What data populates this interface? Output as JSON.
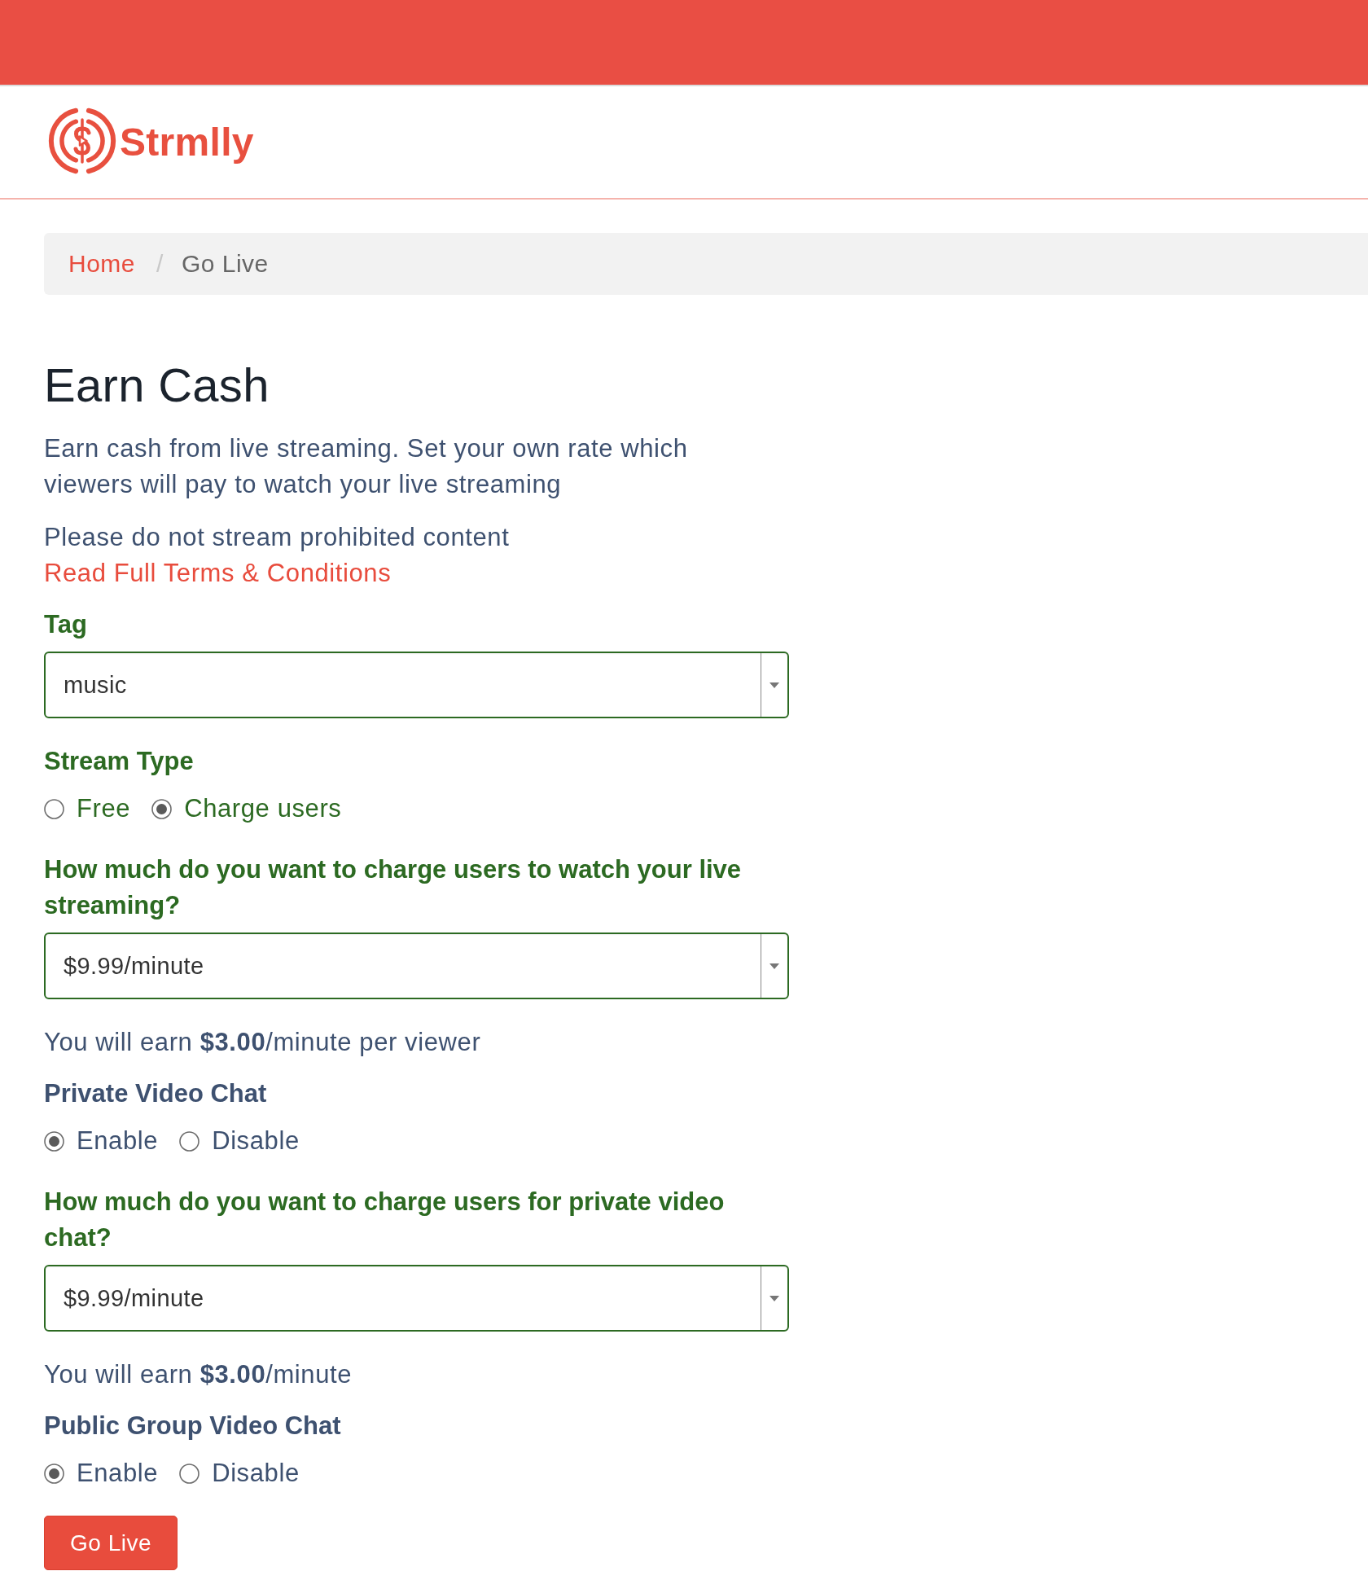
{
  "header": {
    "logo_text": "Strmlly"
  },
  "breadcrumb": {
    "separator": "/",
    "items": [
      {
        "label": "Home",
        "kind": "link"
      },
      {
        "label": "Go Live",
        "kind": "current"
      }
    ]
  },
  "page": {
    "title": "Earn Cash",
    "intro": "Earn cash from live streaming. Set your own rate which viewers will pay to watch your live streaming",
    "notice": "Please do not stream prohibited content",
    "terms_link": "Read Full Terms & Conditions"
  },
  "form": {
    "fields": [
      {
        "kind": "select",
        "label": "Tag",
        "value": "music",
        "valid": true
      },
      {
        "kind": "radio",
        "label": "Stream Type",
        "valid": true,
        "options": [
          {
            "label": "Free",
            "selected": false
          },
          {
            "label": "Charge users",
            "selected": true
          }
        ]
      },
      {
        "kind": "select",
        "label": "How much do you want to charge users to watch your live streaming?",
        "value": "$9.99/minute",
        "valid": true
      },
      {
        "kind": "note",
        "text": "You will earn **$3.00**/minute per viewer"
      },
      {
        "kind": "radio",
        "label": "Private Video Chat",
        "valid": false,
        "options": [
          {
            "label": "Enable",
            "selected": true
          },
          {
            "label": "Disable",
            "selected": false
          }
        ]
      },
      {
        "kind": "select",
        "label": "How much do you want to charge users for private video chat?",
        "value": "$9.99/minute",
        "valid": true
      },
      {
        "kind": "note",
        "text": "You will earn **$3.00**/minute"
      },
      {
        "kind": "radio",
        "label": "Public Group Video Chat",
        "valid": false,
        "options": [
          {
            "label": "Enable",
            "selected": true
          },
          {
            "label": "Disable",
            "selected": false
          }
        ]
      }
    ],
    "submit_button": "Go Live"
  }
}
